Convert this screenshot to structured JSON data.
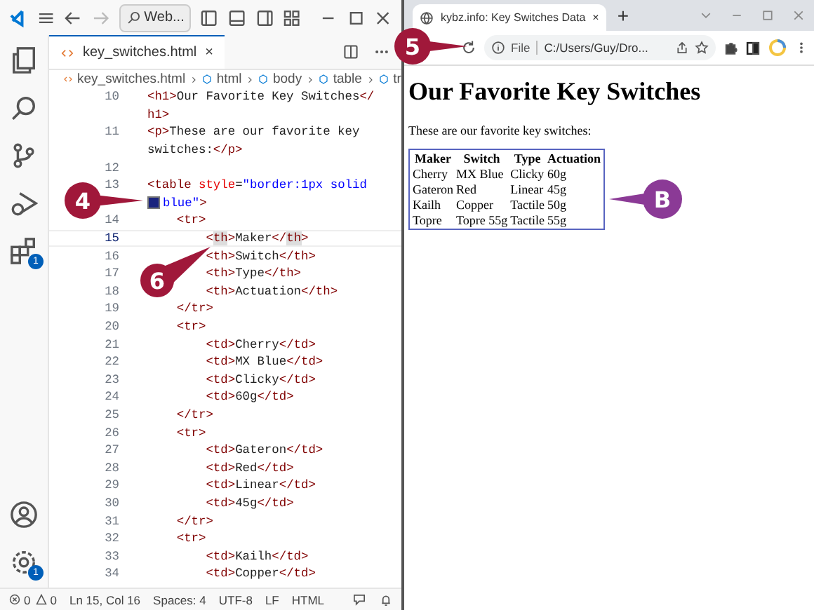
{
  "editor_window": {
    "search": "Web...",
    "tab": {
      "label": "key_switches.html",
      "close": "×"
    },
    "breadcrumb": [
      "key_switches.html",
      "html",
      "body",
      "table",
      "tr"
    ],
    "activity_badges": {
      "extensions": "1",
      "settings": "1"
    },
    "lines": [
      {
        "number": "10",
        "current": false,
        "rows": [
          {
            "segments": [
              {
                "kind": "tag",
                "text": "<h1>"
              },
              {
                "kind": "plain",
                "text": "Our Favorite Key Switches"
              },
              {
                "kind": "tag",
                "text": "</"
              }
            ]
          },
          {
            "segments": [
              {
                "kind": "tag",
                "text": "h1>"
              }
            ]
          }
        ]
      },
      {
        "number": "11",
        "current": false,
        "rows": [
          {
            "segments": [
              {
                "kind": "tag",
                "text": "<p>"
              },
              {
                "kind": "plain",
                "text": "These are our favorite key"
              }
            ]
          },
          {
            "segments": [
              {
                "kind": "plain",
                "text": "switches:"
              },
              {
                "kind": "tag",
                "text": "</p>"
              }
            ]
          }
        ]
      },
      {
        "number": "12",
        "current": false,
        "rows": [
          {
            "segments": []
          }
        ]
      },
      {
        "number": "13",
        "current": false,
        "rows": [
          {
            "segments": [
              {
                "kind": "tag",
                "text": "<table "
              },
              {
                "kind": "attr",
                "text": "style"
              },
              {
                "kind": "plain",
                "text": "="
              },
              {
                "kind": "string",
                "text": "\"border:1px solid"
              }
            ]
          },
          {
            "segments": [
              {
                "kind": "swatch",
                "color": "#1a237e"
              },
              {
                "kind": "string",
                "text": "blue\""
              },
              {
                "kind": "tag",
                "text": ">"
              }
            ]
          }
        ]
      },
      {
        "number": "14",
        "current": false,
        "rows": [
          {
            "segments": [
              {
                "kind": "tag",
                "text": "    <tr>"
              }
            ]
          }
        ]
      },
      {
        "number": "15",
        "current": true,
        "rows": [
          {
            "segments": [
              {
                "kind": "tag",
                "text": "        <"
              },
              {
                "kind": "tag",
                "text": "th",
                "matched": true
              },
              {
                "kind": "tag",
                "text": ">"
              },
              {
                "kind": "plain",
                "text": "Maker"
              },
              {
                "kind": "tag",
                "text": "</"
              },
              {
                "kind": "tag",
                "text": "th",
                "matched": true
              },
              {
                "kind": "tag",
                "text": ">"
              }
            ]
          }
        ]
      },
      {
        "number": "16",
        "current": false,
        "rows": [
          {
            "segments": [
              {
                "kind": "tag",
                "text": "        <th>"
              },
              {
                "kind": "plain",
                "text": "Switch"
              },
              {
                "kind": "tag",
                "text": "</th>"
              }
            ]
          }
        ]
      },
      {
        "number": "17",
        "current": false,
        "rows": [
          {
            "segments": [
              {
                "kind": "tag",
                "text": "        <th>"
              },
              {
                "kind": "plain",
                "text": "Type"
              },
              {
                "kind": "tag",
                "text": "</th>"
              }
            ]
          }
        ]
      },
      {
        "number": "18",
        "current": false,
        "rows": [
          {
            "segments": [
              {
                "kind": "tag",
                "text": "        <th>"
              },
              {
                "kind": "plain",
                "text": "Actuation"
              },
              {
                "kind": "tag",
                "text": "</th>"
              }
            ]
          }
        ]
      },
      {
        "number": "19",
        "current": false,
        "rows": [
          {
            "segments": [
              {
                "kind": "tag",
                "text": "    </tr>"
              }
            ]
          }
        ]
      },
      {
        "number": "20",
        "current": false,
        "rows": [
          {
            "segments": [
              {
                "kind": "tag",
                "text": "    <tr>"
              }
            ]
          }
        ]
      },
      {
        "number": "21",
        "current": false,
        "rows": [
          {
            "segments": [
              {
                "kind": "tag",
                "text": "        <td>"
              },
              {
                "kind": "plain",
                "text": "Cherry"
              },
              {
                "kind": "tag",
                "text": "</td>"
              }
            ]
          }
        ]
      },
      {
        "number": "22",
        "current": false,
        "rows": [
          {
            "segments": [
              {
                "kind": "tag",
                "text": "        <td>"
              },
              {
                "kind": "plain",
                "text": "MX Blue"
              },
              {
                "kind": "tag",
                "text": "</td>"
              }
            ]
          }
        ]
      },
      {
        "number": "23",
        "current": false,
        "rows": [
          {
            "segments": [
              {
                "kind": "tag",
                "text": "        <td>"
              },
              {
                "kind": "plain",
                "text": "Clicky"
              },
              {
                "kind": "tag",
                "text": "</td>"
              }
            ]
          }
        ]
      },
      {
        "number": "24",
        "current": false,
        "rows": [
          {
            "segments": [
              {
                "kind": "tag",
                "text": "        <td>"
              },
              {
                "kind": "plain",
                "text": "60g"
              },
              {
                "kind": "tag",
                "text": "</td>"
              }
            ]
          }
        ]
      },
      {
        "number": "25",
        "current": false,
        "rows": [
          {
            "segments": [
              {
                "kind": "tag",
                "text": "    </tr>"
              }
            ]
          }
        ]
      },
      {
        "number": "26",
        "current": false,
        "rows": [
          {
            "segments": [
              {
                "kind": "tag",
                "text": "    <tr>"
              }
            ]
          }
        ]
      },
      {
        "number": "27",
        "current": false,
        "rows": [
          {
            "segments": [
              {
                "kind": "tag",
                "text": "        <td>"
              },
              {
                "kind": "plain",
                "text": "Gateron"
              },
              {
                "kind": "tag",
                "text": "</td>"
              }
            ]
          }
        ]
      },
      {
        "number": "28",
        "current": false,
        "rows": [
          {
            "segments": [
              {
                "kind": "tag",
                "text": "        <td>"
              },
              {
                "kind": "plain",
                "text": "Red"
              },
              {
                "kind": "tag",
                "text": "</td>"
              }
            ]
          }
        ]
      },
      {
        "number": "29",
        "current": false,
        "rows": [
          {
            "segments": [
              {
                "kind": "tag",
                "text": "        <td>"
              },
              {
                "kind": "plain",
                "text": "Linear"
              },
              {
                "kind": "tag",
                "text": "</td>"
              }
            ]
          }
        ]
      },
      {
        "number": "30",
        "current": false,
        "rows": [
          {
            "segments": [
              {
                "kind": "tag",
                "text": "        <td>"
              },
              {
                "kind": "plain",
                "text": "45g"
              },
              {
                "kind": "tag",
                "text": "</td>"
              }
            ]
          }
        ]
      },
      {
        "number": "31",
        "current": false,
        "rows": [
          {
            "segments": [
              {
                "kind": "tag",
                "text": "    </tr>"
              }
            ]
          }
        ]
      },
      {
        "number": "32",
        "current": false,
        "rows": [
          {
            "segments": [
              {
                "kind": "tag",
                "text": "    <tr>"
              }
            ]
          }
        ]
      },
      {
        "number": "33",
        "current": false,
        "rows": [
          {
            "segments": [
              {
                "kind": "tag",
                "text": "        <td>"
              },
              {
                "kind": "plain",
                "text": "Kailh"
              },
              {
                "kind": "tag",
                "text": "</td>"
              }
            ]
          }
        ]
      },
      {
        "number": "34",
        "current": false,
        "rows": [
          {
            "segments": [
              {
                "kind": "tag",
                "text": "        <td>"
              },
              {
                "kind": "plain",
                "text": "Copper"
              },
              {
                "kind": "tag",
                "text": "</td>"
              }
            ]
          }
        ]
      }
    ],
    "status_bar": {
      "errors": "0",
      "warnings": "0",
      "items": [
        "Ln 15, Col 16",
        "Spaces: 4",
        "UTF-8",
        "LF",
        "HTML"
      ]
    }
  },
  "browser_window": {
    "tab": {
      "label": "kybz.info: Key Switches Data",
      "close": "×"
    },
    "new_tab": "+",
    "address": {
      "scheme": "File",
      "url": "C:/Users/Guy/Dro..."
    },
    "page": {
      "heading": "Our Favorite Key Switches",
      "paragraph": "These are our favorite key switches:",
      "table": {
        "columns": [
          "Maker",
          "Switch",
          "Type",
          "Actuation"
        ],
        "rows": [
          [
            "Cherry",
            "MX Blue",
            "Clicky",
            "60g"
          ],
          [
            "Gateron",
            "Red",
            "Linear",
            "45g"
          ],
          [
            "Kailh",
            "Copper",
            "Tactile",
            "50g"
          ],
          [
            "Topre",
            "Topre 55g",
            "Tactile",
            "55g"
          ]
        ]
      }
    }
  },
  "callouts": [
    {
      "label": "4",
      "kind": "step"
    },
    {
      "label": "5",
      "kind": "step"
    },
    {
      "label": "6",
      "kind": "step"
    },
    {
      "label": "B",
      "kind": "note"
    }
  ]
}
